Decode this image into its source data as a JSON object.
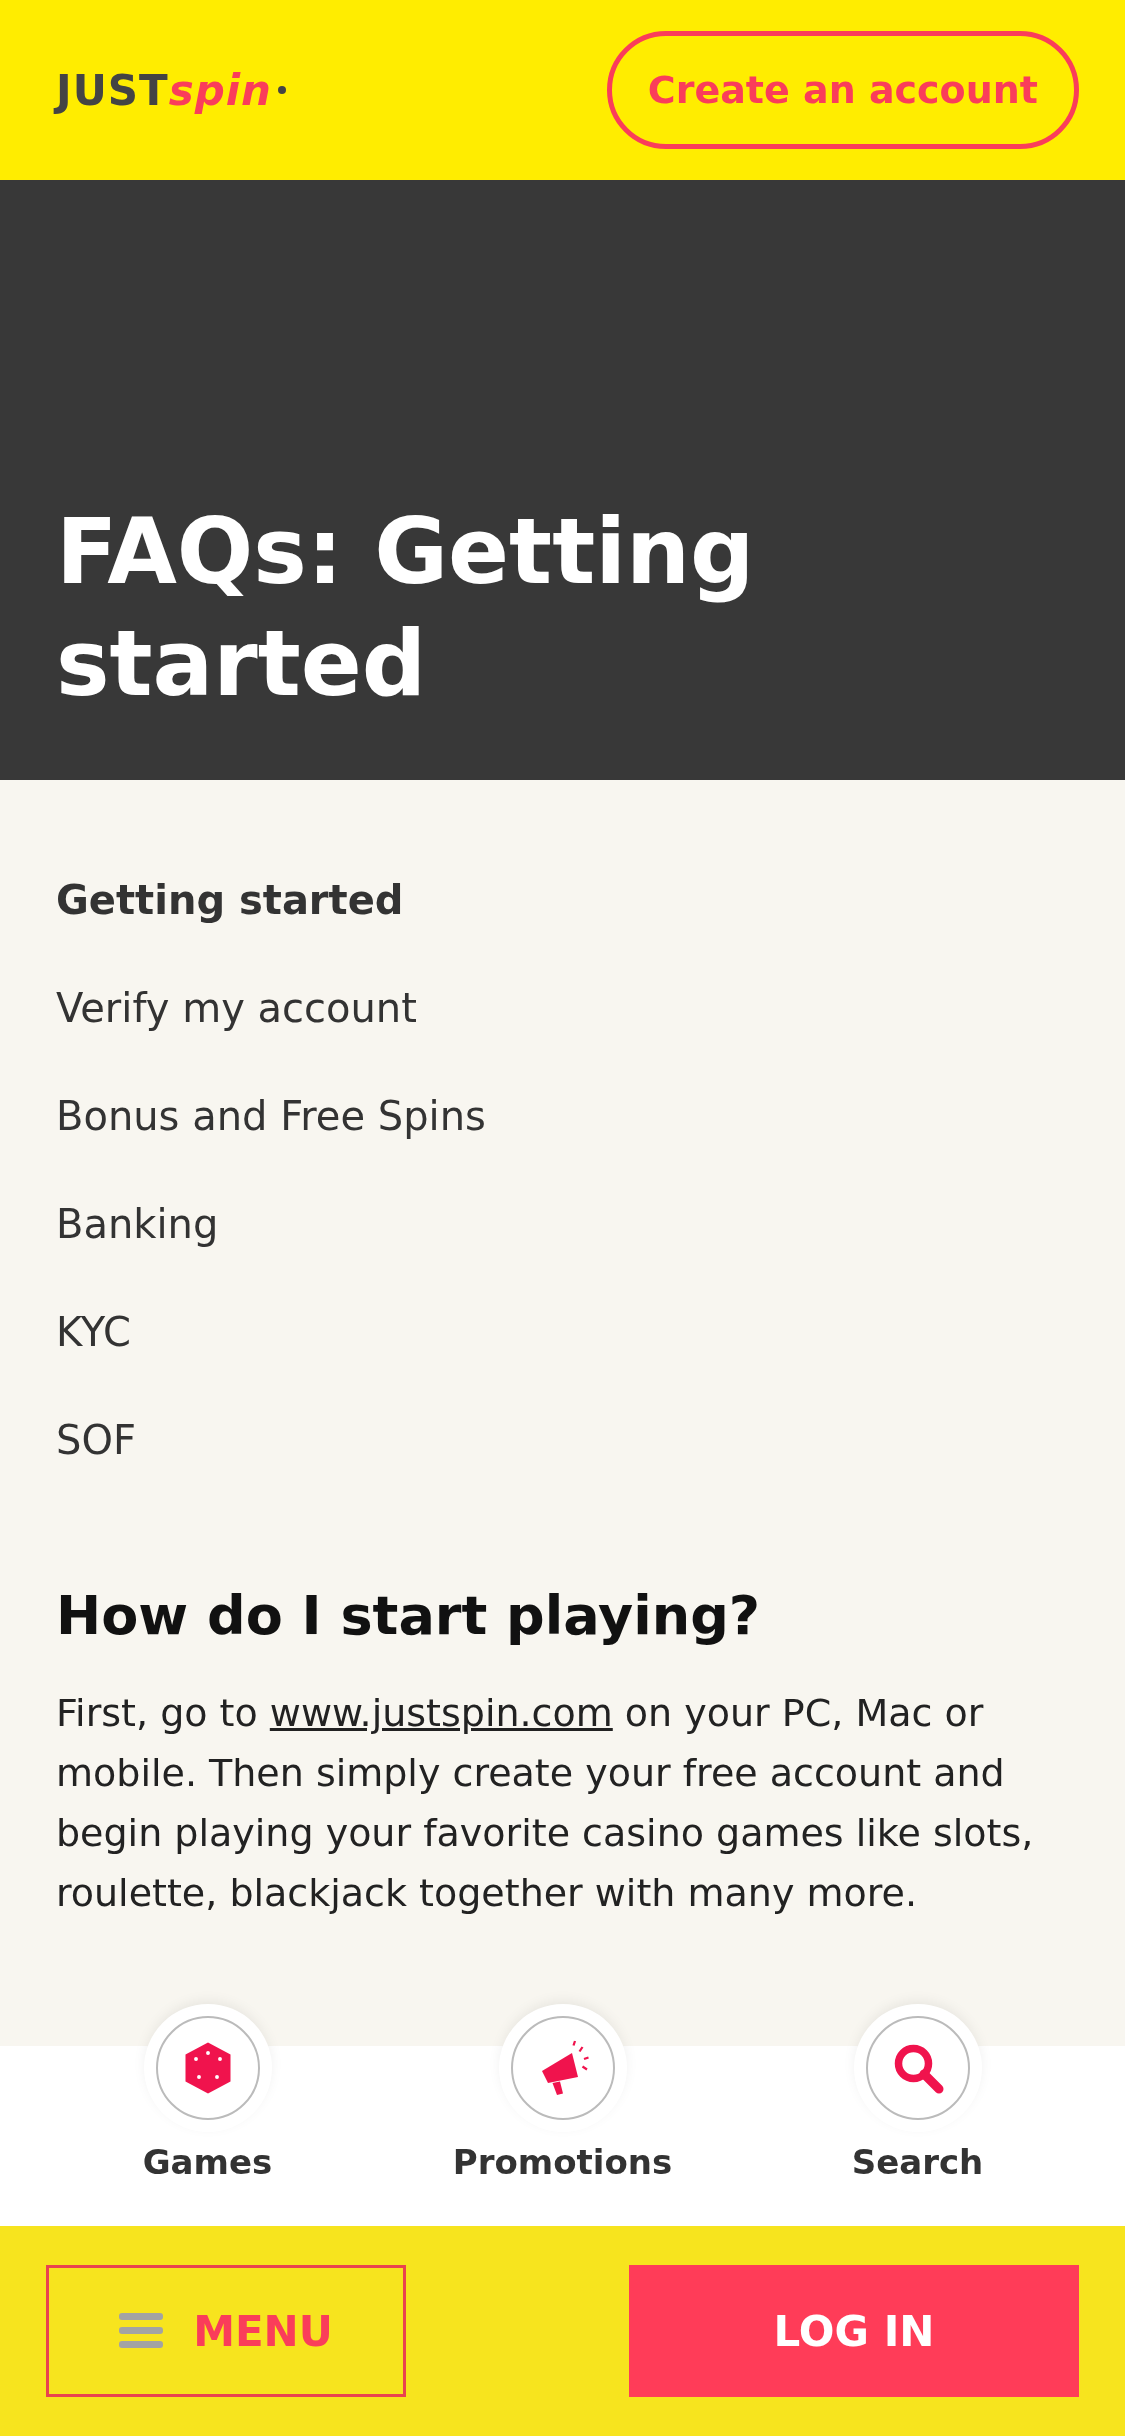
{
  "header": {
    "logo": {
      "first": "JUST",
      "second": "spin"
    },
    "cta": "Create an account"
  },
  "hero": {
    "title": "FAQs: Getting started"
  },
  "categories": [
    {
      "label": "Getting started",
      "selected": true
    },
    {
      "label": "Verify my account",
      "selected": false
    },
    {
      "label": "Bonus and Free Spins",
      "selected": false
    },
    {
      "label": "Banking",
      "selected": false
    },
    {
      "label": "KYC",
      "selected": false
    },
    {
      "label": "SOF",
      "selected": false
    }
  ],
  "article": {
    "question": "How do I start playing?",
    "answer_start": "First, go to",
    "link": "www.justspin.com",
    "answer_end": "on your PC, Mac or mobile. Then simply create your free account and begin playing your favorite casino games like slots, roulette, blackjack together with many more."
  },
  "bottom_nav": [
    {
      "kind": "games",
      "label": "Games"
    },
    {
      "kind": "promotions",
      "label": "Promotions"
    },
    {
      "kind": "search",
      "label": "Search"
    }
  ],
  "footer": {
    "menu": "MENU",
    "login": "LOG IN"
  }
}
